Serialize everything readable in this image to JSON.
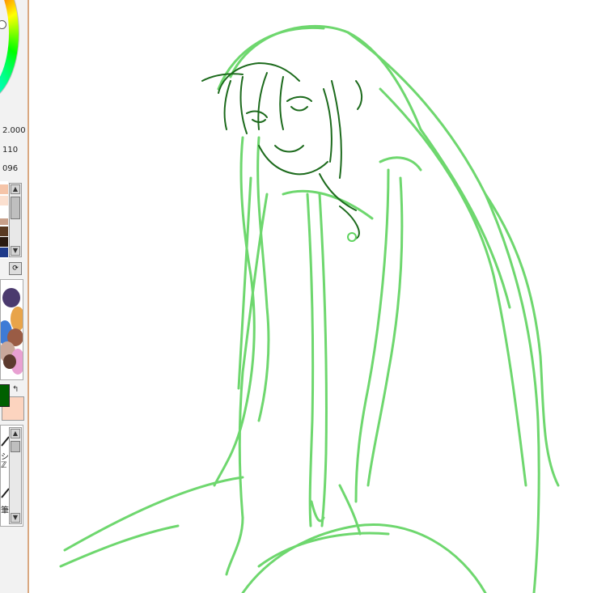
{
  "brush_settings": {
    "size": "2.000",
    "min_size": "110",
    "density": "096"
  },
  "colors": {
    "foreground": "#006000",
    "background": "#fcd4bf",
    "sketch_line": "#5fd35f",
    "ink_line": "#1d6b1d"
  },
  "swatches": [
    "#f5c4a8",
    "#fbe0d0",
    "#ffffff",
    "#c8a08a",
    "#5a3a22",
    "#2a1a10",
    "#1e3a8a"
  ],
  "tools": {
    "items": [
      "",
      "シ",
      "ℤ",
      "",
      "筆"
    ]
  },
  "icons": {
    "swap": "↰",
    "refresh": "⟳",
    "up": "▲",
    "down": "▼"
  }
}
